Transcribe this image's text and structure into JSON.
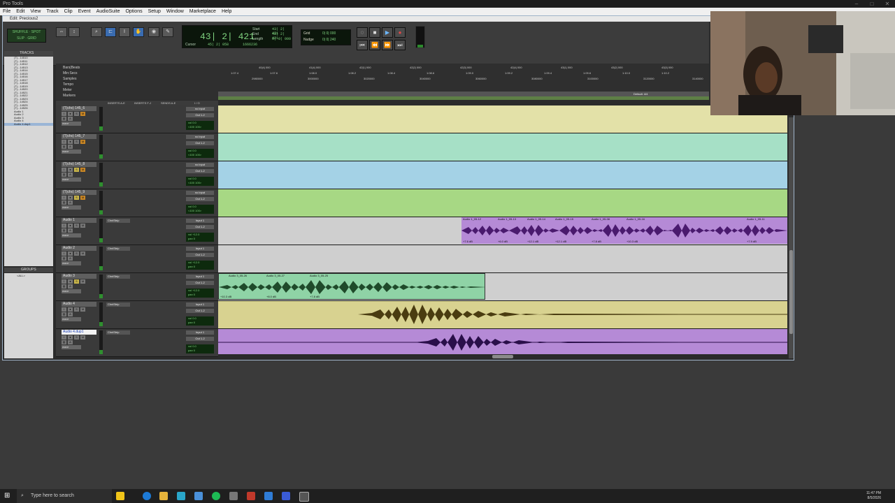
{
  "app": {
    "title": "Pro Tools",
    "edit_window_title": "Edit: Precious2"
  },
  "menu": [
    "File",
    "Edit",
    "View",
    "Track",
    "Clip",
    "Event",
    "AudioSuite",
    "Options",
    "Setup",
    "Window",
    "Marketplace",
    "Help"
  ],
  "toolbar": {
    "modes": {
      "row1": "SHUFFLE · SPOT",
      "row2": "SLIP · GRID"
    },
    "counter": {
      "main": "43| 2| 421",
      "start_label": "Start",
      "start": "43| 2| 421",
      "end_label": "End",
      "end": "43| 2| 421",
      "length_label": "Length",
      "length": "0| 0| 000",
      "cursor_label": "Cursor",
      "cursor": "45| 2| 058",
      "samples": "1666236"
    },
    "grid": {
      "label": "Grid",
      "value": "0| 0| 000"
    },
    "nudge": {
      "label": "Nudge",
      "value": "0| 0| 240"
    }
  },
  "tracks_panel": {
    "header": "TRACKS",
    "items": [
      "(T)...14510",
      "(T)...14511",
      "(T)...14512",
      "(T)...14513",
      "(T)...14514",
      "(T)...14515",
      "(T)...14516",
      "(T)...14517",
      "(T)...14518",
      "(T)...14519",
      "(T)...14520",
      "(T)...14521",
      "(T)...14522",
      "(T)...14523",
      "(T)...14524",
      "(T)...14525",
      "(T)...14526",
      "Audio 1",
      "Audio 2",
      "Audio 3",
      "Audio 4",
      "Audio 4.dup1"
    ]
  },
  "groups_panel": {
    "header": "GROUPS",
    "items": [
      "<ALL>"
    ]
  },
  "rulers": {
    "names": [
      "Bars|Beats",
      "Min:Secs",
      "Samples",
      "Tempo",
      "Meter",
      "Markers"
    ],
    "bars": [
      "40|4| 000",
      "41|4| 000",
      "42|1| 000",
      "42|2| 000",
      "42|3| 000",
      "42|4| 000",
      "43|1| 000",
      "43|2| 000",
      "43|3| 000",
      "43|4| 000",
      "44|1| 000"
    ],
    "minsecs": [
      "1:07.4",
      "1:07.6",
      "1:08.0",
      "1:08.2",
      "1:08.4",
      "1:08.6",
      "1:09.0",
      "1:09.2",
      "1:09.4",
      "1:09.6",
      "1:10.0",
      "1:10.2"
    ],
    "samples": [
      "2980000",
      "3000000",
      "3020000",
      "3040000",
      "3060000",
      "3080000",
      "3100000",
      "3120000",
      "3140000"
    ],
    "meter": "Default: 4/4"
  },
  "columns": {
    "inserts_ae": "INSERTS A-E",
    "inserts_fj": "INSERTS F-J",
    "sends_ae": "SENDS A-E",
    "io": "I / O"
  },
  "tracks": [
    {
      "name": "(T)chx) 145_6",
      "input": "no input",
      "output": "Out 1-2",
      "vol": "vol  0.0",
      "pan": "<100  100>",
      "insert": "",
      "color": "#e3e1a8"
    },
    {
      "name": "(T)chx) 145_7",
      "input": "no input",
      "output": "Out 1-2",
      "vol": "vol  0.0",
      "pan": "<100  100>",
      "insert": "",
      "color": "#a6e0c6"
    },
    {
      "name": "(T)chx) 145_8",
      "input": "no input",
      "output": "Out 1-2",
      "vol": "vol  0.0",
      "pan": "<100  100>",
      "insert": "",
      "color": "#a4d2e6"
    },
    {
      "name": "(T)chx) 145_9",
      "input": "no input",
      "output": "Out 1-2",
      "vol": "vol  0.0",
      "pan": "<100  100>",
      "insert": "",
      "color": "#a7d884"
    },
    {
      "name": "Audio 1",
      "input": "Input 1",
      "output": "Out 1-2",
      "vol": "vol  +12.0",
      "pan": "pan  0",
      "insert": "ChnlStrip",
      "color": "#cfcfcf"
    },
    {
      "name": "Audio 2",
      "input": "Input 1",
      "output": "Out 1-2",
      "vol": "vol  +12.0",
      "pan": "pan  0",
      "insert": "ChnlStrip",
      "color": "#cfcfcf"
    },
    {
      "name": "Audio 3",
      "input": "Input 1",
      "output": "Out 1-2",
      "vol": "vol  +12.0",
      "pan": "pan  0",
      "insert": "ChnlStrip",
      "color": "#cfcfcf"
    },
    {
      "name": "Audio 4",
      "input": "Input 1",
      "output": "Out 1-2",
      "vol": "vol  0.0",
      "pan": "pan  0",
      "insert": "ChnlStrip",
      "color": "#cfcfcf"
    },
    {
      "name": "Audio 4.dup1",
      "input": "Input 1",
      "output": "Out 1-2",
      "vol": "vol  0.0",
      "pan": "pan  0",
      "insert": "ChnlStrip",
      "color": "#cfcfcf"
    }
  ],
  "clips": {
    "audio1": [
      {
        "name": "Audio 1_05-12",
        "gain": "+7.6 dB"
      },
      {
        "name": "Audio 1_05-13",
        "gain": "+6.0 dB"
      },
      {
        "name": "Audio 1_05-14",
        "gain": "+12.1 dB"
      },
      {
        "name": "Audio 1_05-15",
        "gain": "+12.1 dB"
      },
      {
        "name": "Audio 1_05-08",
        "gain": "+7.8 dB"
      },
      {
        "name": "Audio 1_05-16",
        "gain": "+10.3 dB"
      },
      {
        "name": "Audio 1_05-11",
        "gain": "+7.9 dB"
      }
    ],
    "audio3": [
      {
        "name": "Audio 3_05-26",
        "gain": "+10.3 dB"
      },
      {
        "name": "Audio 3_05-27",
        "gain": "+8.0 dB"
      },
      {
        "name": "Audio 3_05-25",
        "gain": "+7.8 dB"
      }
    ]
  },
  "taskbar": {
    "search_placeholder": "Type here to search",
    "time": "11:47 PM",
    "date": "8/5/2026"
  }
}
